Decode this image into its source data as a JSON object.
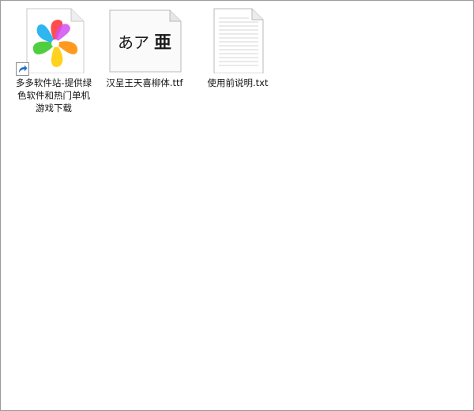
{
  "files": [
    {
      "name": "多多软件站-提供绿色软件和热门单机游戏下载",
      "icon": "pinwheel-shortcut-icon",
      "is_shortcut": true
    },
    {
      "name": "汉呈王天喜柳体.ttf",
      "icon": "font-file-icon",
      "preview_text": "あア",
      "preview_glyph": "亜"
    },
    {
      "name": "使用前说明.txt",
      "icon": "text-file-icon"
    }
  ],
  "colors": {
    "window_border": "#9a9a9a",
    "background": "#ffffff",
    "shortcut_arrow_blue": "#2a6fc9",
    "pinwheel": [
      "#ff4d4d",
      "#ff9a1f",
      "#ffd21f",
      "#4fcf3f",
      "#2fb6f0",
      "#7b5cf0",
      "#d14ff0"
    ]
  }
}
